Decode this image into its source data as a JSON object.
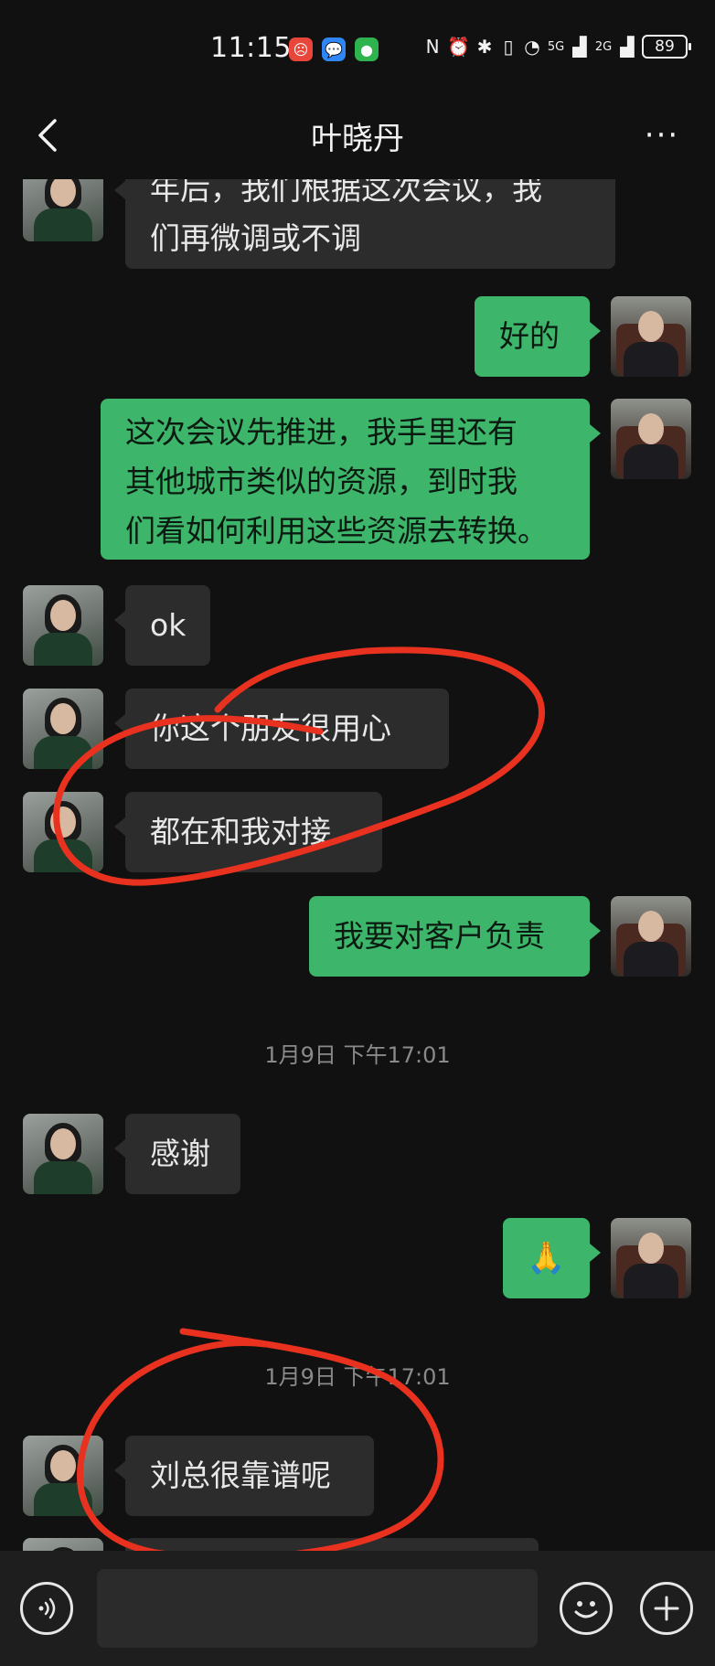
{
  "status_bar": {
    "time": "11:15",
    "battery": "89",
    "network_5g": "5G",
    "network_2g": "2G"
  },
  "header": {
    "title": "叶晓丹",
    "more_label": "···"
  },
  "messages": [
    {
      "sender": "other",
      "lines": [
        "年后，我们根据这次会议，我",
        "们再微调或不调"
      ]
    },
    {
      "sender": "me",
      "text": "好的"
    },
    {
      "sender": "me",
      "lines": [
        "这次会议先推进，我手里还有",
        "其他城市类似的资源，到时我",
        "们看如何利用这些资源去转换。"
      ]
    },
    {
      "sender": "other",
      "text": "ok"
    },
    {
      "sender": "other",
      "text": "你这个朋友很用心"
    },
    {
      "sender": "other",
      "text": "都在和我对接"
    },
    {
      "sender": "me",
      "text": "我要对客户负责"
    },
    {
      "timestamp": "1月9日 下午17:01"
    },
    {
      "sender": "other",
      "text": "感谢"
    },
    {
      "sender": "me",
      "emoji": "🙏"
    },
    {
      "timestamp": "1月9日 下午17:01"
    },
    {
      "sender": "other",
      "text": "刘总很靠谱呢"
    }
  ],
  "annotations": {
    "color": "#e8321f"
  },
  "input_bar": {
    "placeholder": ""
  }
}
